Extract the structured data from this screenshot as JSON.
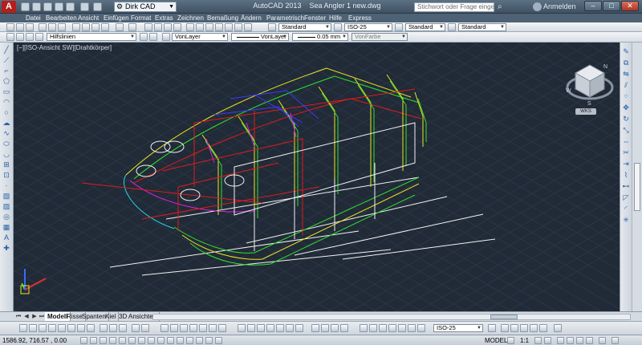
{
  "app": {
    "window_title": "AutoCAD 2013",
    "document_title": "Sea Angler 1 new.dwg",
    "workspace": "Dirk CAD",
    "search_placeholder": "Stichwort oder Frage eingeben",
    "signin_label": "Anmelden"
  },
  "menu": [
    {
      "label": "Datei",
      "icon": "menu-file"
    },
    {
      "label": "Bearbeiten",
      "icon": "menu-edit"
    },
    {
      "label": "Ansicht",
      "icon": "menu-view"
    },
    {
      "label": "Einfügen",
      "icon": "menu-insert"
    },
    {
      "label": "Format",
      "icon": "menu-format"
    },
    {
      "label": "Extras",
      "icon": "menu-tools"
    },
    {
      "label": "Zeichnen",
      "icon": "menu-draw"
    },
    {
      "label": "Bemaßung",
      "icon": "menu-dimension"
    },
    {
      "label": "Ändern",
      "icon": "menu-modify"
    },
    {
      "label": "Parametrisch",
      "icon": "menu-parametric"
    },
    {
      "label": "Fenster",
      "icon": "menu-window"
    },
    {
      "label": "Hilfe",
      "icon": "menu-help"
    },
    {
      "label": "Express",
      "icon": "menu-express"
    }
  ],
  "toolbar1": {
    "text_style": "Standard",
    "dim_style": "ISO-25",
    "table_style": "Standard",
    "multileader_style": "Standard"
  },
  "toolbar2": {
    "layer": "Hilfslinien",
    "color": "VonLayer",
    "linetype": "VonLayer",
    "lineweight": "0.05 mm",
    "plotstyle": "VonFarbe"
  },
  "viewport": {
    "label": "[−][ISO-Ansicht SW][Drahtkörper]",
    "viewcube_wcs": "WKS",
    "viewcube_compass": [
      "N",
      "W",
      "S"
    ],
    "background": "#212a37"
  },
  "layout_tabs": [
    "Modell",
    "Risse",
    "Spanten",
    "Kiel",
    "3D Ansichten"
  ],
  "active_tab": "Modell",
  "status": {
    "coordinates": "1586.92, 716.57 , 0.00",
    "dim_style_bottom": "ISO-25",
    "space": "MODELL",
    "scale": "1:1"
  },
  "colors": {
    "hull_red": "#e01b1b",
    "hull_green": "#2fe02f",
    "hull_yellow": "#e8e820",
    "hull_white": "#f2f2f2",
    "hull_blue": "#3b3bff",
    "hull_magenta": "#e020e0",
    "hull_cyan": "#20d8e8",
    "title_bar": "#4e6275",
    "logo_red": "#b2201c"
  }
}
